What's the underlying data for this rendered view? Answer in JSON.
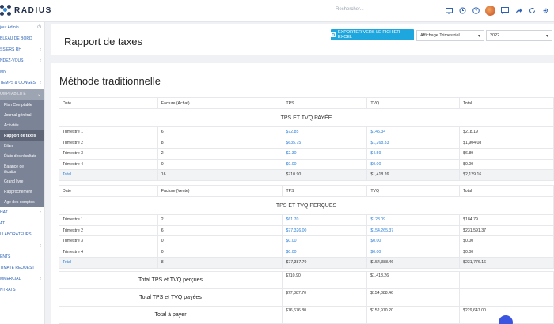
{
  "app": {
    "name": "RADIUS"
  },
  "topbar": {
    "search_placeholder": "Rechercher...",
    "icons": [
      "monitor-icon",
      "history-icon",
      "help-icon",
      "chat-icon",
      "share-icon",
      "refresh-icon",
      "settings-icon"
    ]
  },
  "sidebar": {
    "items": [
      {
        "label": "jour Admin",
        "icon": "power-icon"
      },
      {
        "label": "BLEAU DE BORD"
      },
      {
        "label": "SSIERS RH",
        "chevron": "‹"
      },
      {
        "label": "NDEZ-VOUS",
        "chevron": "‹"
      },
      {
        "label": "MN"
      },
      {
        "label": "TEMPS & CONGÉS",
        "chevron": "‹"
      },
      {
        "label": "OMPTABILITÉ",
        "chevron": "⌄"
      }
    ],
    "submenu": [
      "Plan Comptable",
      "Journal général",
      "Activités",
      "Rapport de taxes",
      "Bilan",
      "États des résultats",
      "Balance de\nification",
      "Grand livre",
      "Rapprochement",
      "Age des comptes"
    ],
    "items_after": [
      {
        "label": "HAT",
        "chevron": "‹"
      },
      {
        "label": "AT"
      },
      {
        "label": "LLABORATEURS"
      },
      {
        "label": "",
        "chevron": "‹"
      },
      {
        "label": "ENTS"
      },
      {
        "label": "TIMATE REQUEST"
      },
      {
        "label": "MMERCIAL",
        "chevron": "‹"
      },
      {
        "label": "NTRATS"
      }
    ]
  },
  "header": {
    "title": "Rapport de taxes",
    "export_label": "EXPORTER VERS LE FICHIER EXCEL",
    "display_select": "Affichage Trimestriel",
    "year_select": "2022"
  },
  "section": {
    "title": "Méthode traditionnelle"
  },
  "paid_table": {
    "headers": [
      "Date",
      "Facture (Achat)",
      "TPS",
      "TVQ",
      "Total"
    ],
    "caption": "TPS ET TVQ PAYÉE",
    "rows": [
      [
        "Trimestre 1",
        "6",
        "$72.85",
        "$145.34",
        "$218.19"
      ],
      [
        "Trimestre 2",
        "8",
        "$635.75",
        "$1,268.33",
        "$1,904.08"
      ],
      [
        "Trimestre 3",
        "2",
        "$2.30",
        "$4.59",
        "$6.89"
      ],
      [
        "Trimestre 4",
        "0",
        "$0.00",
        "$0.00",
        "$0.00"
      ]
    ],
    "total": [
      "Total",
      "16",
      "$710.90",
      "$1,418.26",
      "$2,129.16"
    ]
  },
  "collected_table": {
    "headers": [
      "Date",
      "Facture (Vente)",
      "TPS",
      "TVQ",
      "Total"
    ],
    "caption": "TPS ET TVQ PERÇUES",
    "rows": [
      [
        "Trimestre 1",
        "2",
        "$61.70",
        "$123.09",
        "$184.79"
      ],
      [
        "Trimestre 2",
        "6",
        "$77,326.00",
        "$154,265.37",
        "$231,591.37"
      ],
      [
        "Trimestre 3",
        "0",
        "$0.00",
        "$0.00",
        "$0.00"
      ],
      [
        "Trimestre 4",
        "0",
        "$0.00",
        "$0.00",
        "$0.00"
      ]
    ],
    "total": [
      "Total",
      "8",
      "$77,387.70",
      "$154,388.46",
      "$231,776.16"
    ]
  },
  "summary": [
    {
      "label": "Total TPS et TVQ perçues",
      "tps": "$710.90",
      "tvq": "$1,418.26",
      "total": ""
    },
    {
      "label": "Total TPS et TVQ payées",
      "tps": "$77,387.70",
      "tvq": "$154,388.46",
      "total": ""
    },
    {
      "label": "Total à payer",
      "tps": "$76,676.80",
      "tvq": "$152,970.20",
      "total": "$229,647.00"
    }
  ],
  "colors": {
    "accent": "#1ea7df",
    "link": "#2d7fd6",
    "sidebar_active": "#7b8396"
  }
}
